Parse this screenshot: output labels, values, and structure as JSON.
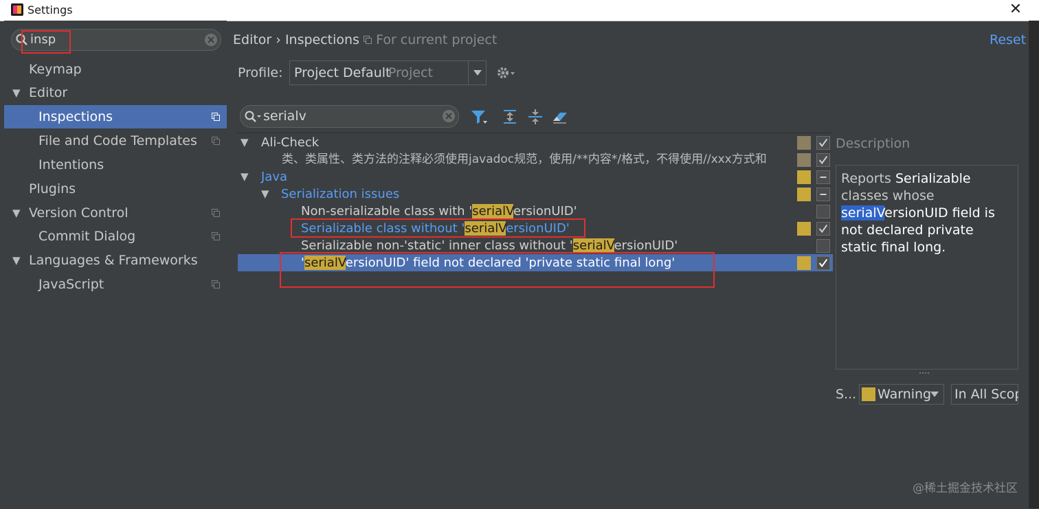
{
  "window": {
    "title": "Settings",
    "close_glyph": "✕"
  },
  "sidebar": {
    "search_value": "insp",
    "items": [
      {
        "label": "Keymap",
        "expand": "",
        "project_icon": false
      },
      {
        "label": "Editor",
        "expand": "▼",
        "project_icon": false
      },
      {
        "label": "Inspections",
        "expand": "",
        "project_icon": true,
        "selected": true
      },
      {
        "label": "File and Code Templates",
        "expand": "",
        "project_icon": true
      },
      {
        "label": "Intentions",
        "expand": "",
        "project_icon": false
      },
      {
        "label": "Plugins",
        "expand": "",
        "project_icon": false
      },
      {
        "label": "Version Control",
        "expand": "▼",
        "project_icon": true
      },
      {
        "label": "Commit Dialog",
        "expand": "",
        "project_icon": true
      },
      {
        "label": "Languages & Frameworks",
        "expand": "▼",
        "project_icon": false
      },
      {
        "label": "JavaScript",
        "expand": "",
        "project_icon": true
      }
    ]
  },
  "header": {
    "breadcrumb_root": "Editor",
    "breadcrumb_sep": "›",
    "breadcrumb_page": "Inspections",
    "scope_note": "For current project",
    "reset_label": "Reset"
  },
  "profile": {
    "label": "Profile:",
    "value": "Project Default",
    "scope": "Project"
  },
  "filter": {
    "search_value": "serialv"
  },
  "tree": {
    "ali_check": "Ali-Check",
    "ali_rule": "类、类属性、类方法的注释必须使用javadoc规范，使用/**内容*/格式，不得使用//xxx方式和",
    "java": "Java",
    "serialization": "Serialization issues",
    "r1_pre": "Non-serializable class with '",
    "r2_pre": "Serializable class without '",
    "r3_pre": "Serializable non-'static' inner class without '",
    "r4_pre": "'",
    "hl": "serialV",
    "post": "ersionUID'",
    "r4_post": "ersionUID' field not declared 'private static final long'"
  },
  "description": {
    "label": "Description",
    "t1": "Reports ",
    "t2": "Serializable",
    "t3": " classes whose ",
    "t4": "serialV",
    "t5": "ersionUID field is not declared private static final long."
  },
  "options": {
    "severity_label": "S...",
    "severity_value": "Warning",
    "scope_value": "In All Scopes"
  },
  "watermark": "@稀土掘金技术社区",
  "colors": {
    "accent": "#4b6eaf",
    "warning": "#c9a93a",
    "link": "#589df6",
    "highlight_box": "#e03030"
  }
}
